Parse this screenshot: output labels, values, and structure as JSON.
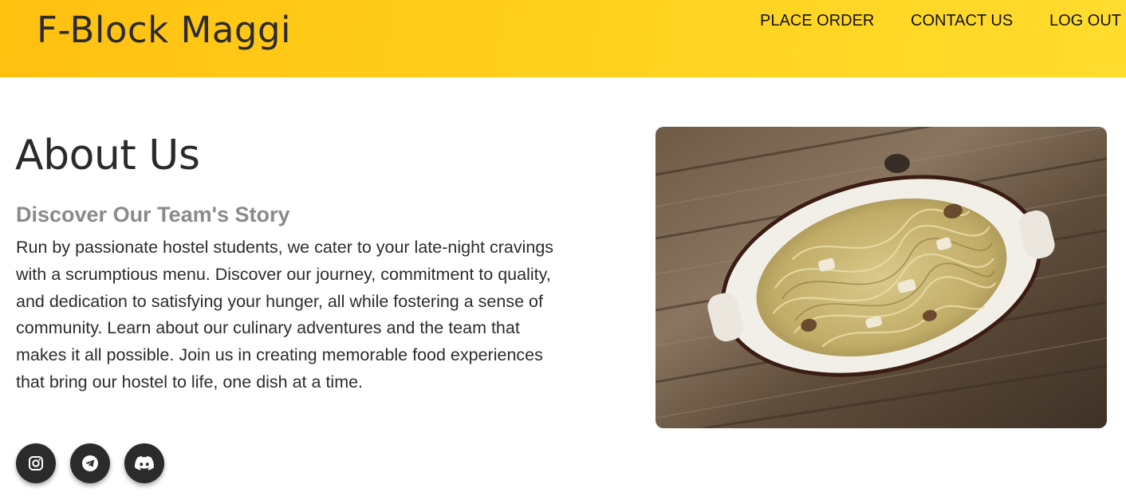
{
  "header": {
    "brand": "F-Block Maggi",
    "nav": [
      {
        "label": "PLACE ORDER"
      },
      {
        "label": "CONTACT US"
      },
      {
        "label": "LOG OUT"
      }
    ]
  },
  "about": {
    "title": "About Us",
    "subtitle": "Discover Our Team's Story",
    "body": "Run by passionate hostel students, we cater to your late-night cravings with a scrumptious menu. Discover our journey, commitment to quality, and dedication to satisfying your hunger, all while fostering a sense of community. Learn about our culinary adventures and the team that makes it all possible. Join us in creating memorable food experiences that bring our hostel to life, one dish at a time."
  },
  "socials": [
    {
      "icon": "instagram-icon"
    },
    {
      "icon": "telegram-icon"
    },
    {
      "icon": "discord-icon"
    }
  ],
  "image": {
    "subject": "pasta-dish-photo"
  },
  "colors": {
    "header_start": "#ffc010",
    "header_end": "#ffdc2e",
    "social_bg": "#2b2b2b",
    "subtitle": "#8a8a8a"
  }
}
